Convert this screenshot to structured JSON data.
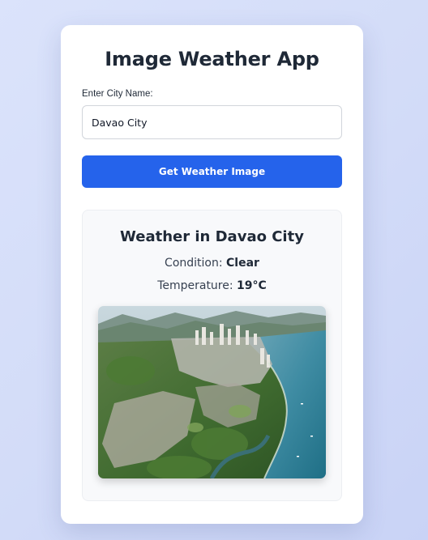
{
  "app": {
    "title": "Image Weather App"
  },
  "form": {
    "city_label": "Enter City Name:",
    "city_value": "Davao City",
    "submit_label": "Get Weather Image"
  },
  "result": {
    "heading": "Weather in Davao City",
    "condition_label": "Condition:",
    "condition_value": "Clear",
    "temperature_label": "Temperature:",
    "temperature_value": "19°C",
    "image_alt": "Aerial view of Davao City"
  },
  "colors": {
    "accent": "#2563eb",
    "background": "#d6defa",
    "card": "#ffffff",
    "panel": "#f8f9fb"
  }
}
